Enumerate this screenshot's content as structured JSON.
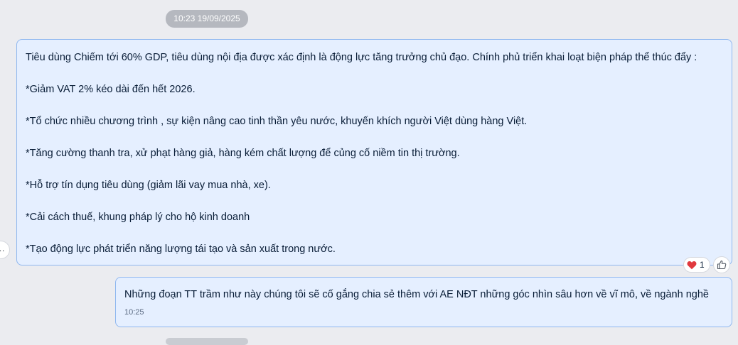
{
  "timestamp_divider": "10:23 19/09/2025",
  "message": {
    "lines": [
      "Tiêu dùng Chiếm tới 60% GDP, tiêu dùng nội địa được xác định là động lực tăng trưởng chủ đạo. Chính phủ triển khai loạt biện pháp thể thúc đẩy :",
      "",
      "*Giảm VAT 2% kéo dài đến hết 2026.",
      "",
      "*Tổ chức nhiều chương trình , sự kiện nâng cao tinh thần yêu nước, khuyến khích người Việt dùng hàng Việt.",
      "",
      "*Tăng cường thanh tra, xử phạt hàng giả, hàng kém chất lượng để củng cố niềm tin thị trường.",
      "",
      "*Hỗ trợ tín dụng tiêu dùng (giảm lãi vay mua nhà, xe).",
      "",
      "*Cải cách thuế, khung pháp lý cho hộ kinh doanh",
      "",
      "*Tạo động lực phát triển năng lượng tái tạo và sản xuất trong nước."
    ],
    "reaction": {
      "icon": "heart-icon",
      "count": "1",
      "color": "#e0393e"
    },
    "like_icon": "thumbs-up-icon"
  },
  "reply": {
    "text": "Những đoạn TT trầm như này chúng tôi sẽ cố gắng chia sẻ thêm với AE NĐT những góc nhìn sâu hơn về vĩ mô, về ngành nghề",
    "time": "10:25"
  },
  "more_glyph": "…",
  "colors": {
    "background": "#ebecf0",
    "bubble_fill": "#e5efff",
    "bubble_border": "#8fb7ef",
    "text": "#081c36"
  }
}
